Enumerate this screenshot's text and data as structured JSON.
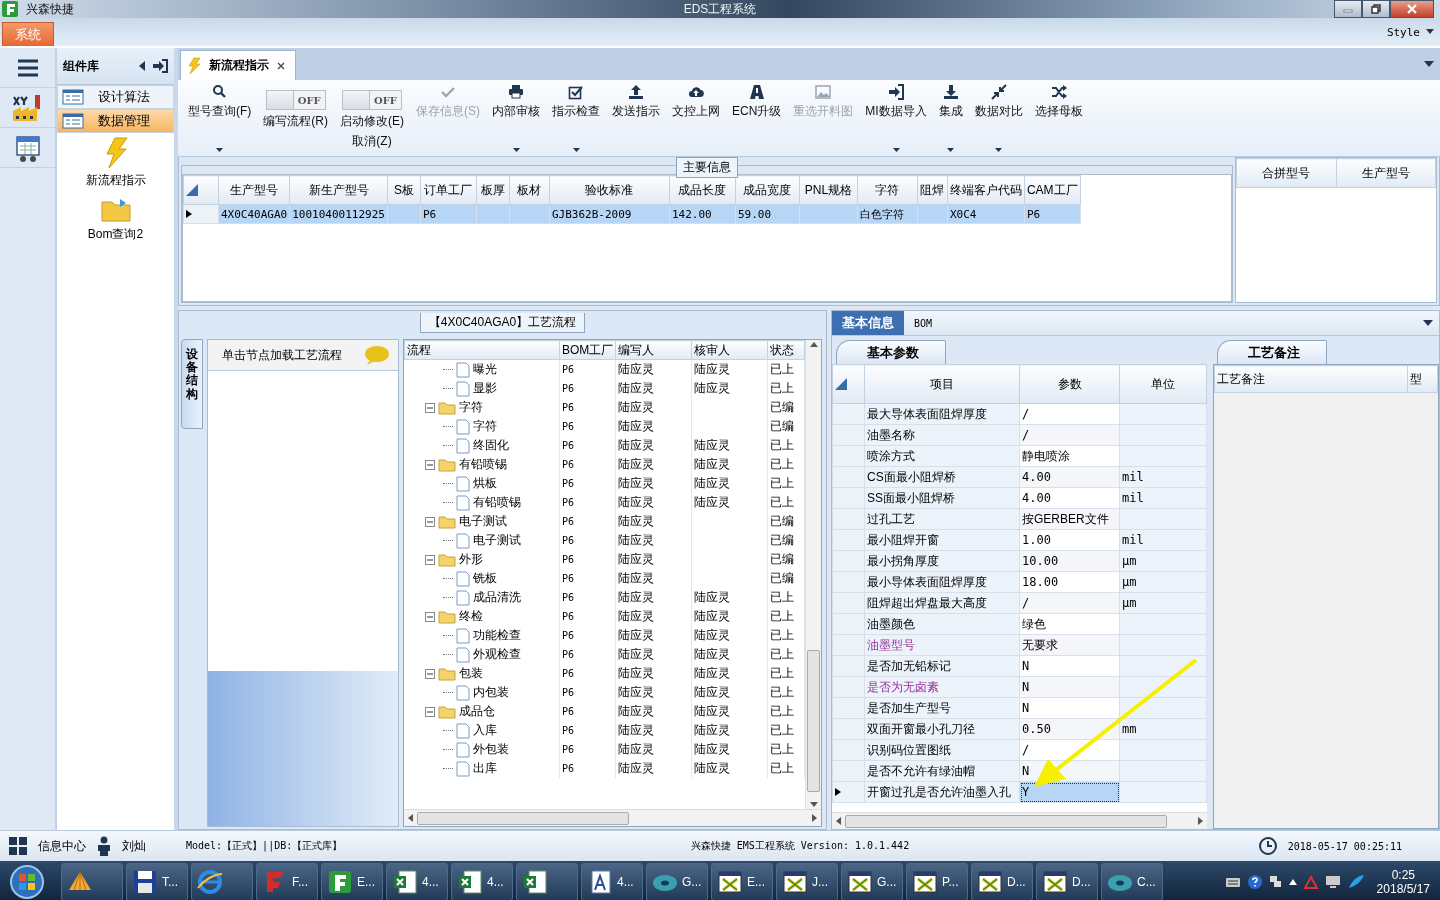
{
  "titlebar": {
    "app": "兴森快捷",
    "title": "EDS工程系统"
  },
  "menu": {
    "system": "系统",
    "style": "Style"
  },
  "component_panel": {
    "title": "组件库",
    "items": [
      {
        "label": "设计算法",
        "selected": false
      },
      {
        "label": "数据管理",
        "selected": true
      }
    ],
    "tools": [
      {
        "label": "新流程指示"
      },
      {
        "label": "Bom查询2"
      }
    ]
  },
  "doc_tabs": [
    {
      "label": "新流程指示",
      "selected": true
    }
  ],
  "toolbar": [
    {
      "kind": "button",
      "lines": [
        "型号查询(F)"
      ],
      "dropdown": true,
      "disabled": false
    },
    {
      "kind": "toggle",
      "text": "OFF",
      "on": false,
      "lines": [
        "编写流程(R)"
      ]
    },
    {
      "kind": "toggle",
      "text": "OFF",
      "on": false,
      "lines": [
        "启动修改(E)",
        "取消(Z)"
      ]
    },
    {
      "kind": "button",
      "lines": [
        "保存信息(S)"
      ],
      "dropdown": false,
      "disabled": true
    },
    {
      "kind": "button",
      "lines": [
        "内部审核"
      ],
      "dropdown": true,
      "disabled": false
    },
    {
      "kind": "button",
      "lines": [
        "指示检查"
      ],
      "dropdown": true,
      "disabled": false
    },
    {
      "kind": "button",
      "lines": [
        "发送指示"
      ],
      "dropdown": false,
      "disabled": false
    },
    {
      "kind": "button",
      "lines": [
        "文控上网"
      ],
      "dropdown": false,
      "disabled": false
    },
    {
      "kind": "button",
      "lines": [
        "ECN升级"
      ],
      "dropdown": false,
      "disabled": false
    },
    {
      "kind": "button",
      "lines": [
        "重选开料图"
      ],
      "dropdown": false,
      "disabled": true
    },
    {
      "kind": "button",
      "lines": [
        "MI数据导入"
      ],
      "dropdown": true,
      "disabled": false
    },
    {
      "kind": "button",
      "lines": [
        "集成"
      ],
      "dropdown": true,
      "disabled": false
    },
    {
      "kind": "button",
      "lines": [
        "数据对比"
      ],
      "dropdown": true,
      "disabled": false
    },
    {
      "kind": "button",
      "lines": [
        "选择母板"
      ],
      "dropdown": false,
      "disabled": false
    }
  ],
  "main_info": {
    "title": "主要信息",
    "columns": [
      "生产型号",
      "新生产型号",
      "S板",
      "订单工厂",
      "板厚",
      "板材",
      "验收标准",
      "成品长度",
      "成品宽度",
      "PNL规格",
      "字符",
      "阻焊",
      "终端客户代码",
      "CAM工厂"
    ],
    "rows": [
      {
        "selected": true,
        "cells": [
          "4X0C40AGA0",
          "10010400112925",
          null,
          "P6",
          null,
          null,
          "GJB362B-2009",
          "142.00",
          "59.00",
          null,
          "白色字符",
          null,
          "X0C4",
          "P6"
        ]
      }
    ],
    "side_columns": [
      "合拼型号",
      "生产型号"
    ]
  },
  "process": {
    "title": "【4X0C40AGA0】工艺流程",
    "side_tab": "设备结构",
    "hint": "单击节点加载工艺流程",
    "columns": [
      "流程",
      "BOM工厂",
      "编写人",
      "核审人",
      "状态"
    ],
    "nodes": [
      {
        "children": [
          {
            "kind": "doc",
            "label": "曝光",
            "bom": "P6",
            "writer": "陆应灵",
            "reviewer": "陆应灵",
            "status": "已上"
          },
          {
            "kind": "doc",
            "label": "显影",
            "bom": "P6",
            "writer": "陆应灵",
            "reviewer": "陆应灵",
            "status": "已上"
          }
        ]
      },
      {
        "kind": "folder",
        "expanded": true,
        "label": "字符",
        "bom": "P6",
        "writer": "陆应灵",
        "status": "已编",
        "children": [
          {
            "kind": "doc",
            "label": "字符",
            "bom": "P6",
            "writer": "陆应灵",
            "status": "已编"
          },
          {
            "kind": "doc",
            "label": "终固化",
            "bom": "P6",
            "writer": "陆应灵",
            "reviewer": "陆应灵",
            "status": "已上"
          }
        ]
      },
      {
        "kind": "folder",
        "expanded": true,
        "label": "有铅喷锡",
        "bom": "P6",
        "writer": "陆应灵",
        "reviewer": "陆应灵",
        "status": "已上",
        "children": [
          {
            "kind": "doc",
            "label": "烘板",
            "bom": "P6",
            "writer": "陆应灵",
            "reviewer": "陆应灵",
            "status": "已上"
          },
          {
            "kind": "doc",
            "label": "有铅喷锡",
            "bom": "P6",
            "writer": "陆应灵",
            "reviewer": "陆应灵",
            "status": "已上"
          }
        ]
      },
      {
        "kind": "folder",
        "expanded": true,
        "label": "电子测试",
        "bom": "P6",
        "writer": "陆应灵",
        "status": "已编",
        "children": [
          {
            "kind": "doc",
            "label": "电子测试",
            "bom": "P6",
            "writer": "陆应灵",
            "status": "已编"
          }
        ]
      },
      {
        "kind": "folder",
        "expanded": true,
        "label": "外形",
        "bom": "P6",
        "writer": "陆应灵",
        "status": "已编",
        "children": [
          {
            "kind": "doc",
            "label": "铣板",
            "bom": "P6",
            "writer": "陆应灵",
            "status": "已编"
          },
          {
            "kind": "doc",
            "label": "成品清洗",
            "bom": "P6",
            "writer": "陆应灵",
            "reviewer": "陆应灵",
            "status": "已上"
          }
        ]
      },
      {
        "kind": "folder",
        "expanded": true,
        "label": "终检",
        "bom": "P6",
        "writer": "陆应灵",
        "reviewer": "陆应灵",
        "status": "已上",
        "children": [
          {
            "kind": "doc",
            "label": "功能检查",
            "bom": "P6",
            "writer": "陆应灵",
            "reviewer": "陆应灵",
            "status": "已上"
          },
          {
            "kind": "doc",
            "label": "外观检查",
            "bom": "P6",
            "writer": "陆应灵",
            "reviewer": "陆应灵",
            "status": "已上"
          }
        ]
      },
      {
        "kind": "folder",
        "expanded": true,
        "label": "包装",
        "bom": "P6",
        "writer": "陆应灵",
        "reviewer": "陆应灵",
        "status": "已上",
        "children": [
          {
            "kind": "doc",
            "label": "内包装",
            "bom": "P6",
            "writer": "陆应灵",
            "reviewer": "陆应灵",
            "status": "已上"
          }
        ]
      },
      {
        "kind": "folder",
        "expanded": true,
        "label": "成品仓",
        "bom": "P6",
        "writer": "陆应灵",
        "reviewer": "陆应灵",
        "status": "已上",
        "children": [
          {
            "kind": "doc",
            "label": "入库",
            "bom": "P6",
            "writer": "陆应灵",
            "reviewer": "陆应灵",
            "status": "已上"
          },
          {
            "kind": "doc",
            "label": "外包装",
            "bom": "P6",
            "writer": "陆应灵",
            "reviewer": "陆应灵",
            "status": "已上"
          },
          {
            "kind": "doc",
            "label": "出库",
            "bom": "P6",
            "writer": "陆应灵",
            "reviewer": "陆应灵",
            "status": "已上"
          }
        ]
      }
    ]
  },
  "info": {
    "tabs": [
      {
        "label": "基本信息",
        "selected": true
      },
      {
        "label": "BOM",
        "selected": false
      }
    ],
    "params": {
      "tab": "基本参数",
      "columns": [
        "项目",
        "参数",
        "单位"
      ],
      "rows": [
        {
          "item": "最大导体表面阻焊厚度",
          "value": "/",
          "selected": false,
          "highlighted": false
        },
        {
          "item": "油墨名称",
          "value": "/",
          "selected": false,
          "highlighted": false
        },
        {
          "item": "喷涂方式",
          "value": "静电喷涂",
          "selected": false,
          "highlighted": false
        },
        {
          "item": "CS面最小阻焊桥",
          "value": "4.00",
          "unit": "mil",
          "selected": false,
          "highlighted": false
        },
        {
          "item": "SS面最小阻焊桥",
          "value": "4.00",
          "unit": "mil",
          "selected": false,
          "highlighted": false
        },
        {
          "item": "过孔工艺",
          "value": "按GERBER文件",
          "selected": false,
          "highlighted": false
        },
        {
          "item": "最小阻焊开窗",
          "value": "1.00",
          "unit": "mil",
          "selected": false,
          "highlighted": false
        },
        {
          "item": "最小拐角厚度",
          "value": "10.00",
          "unit": "μm",
          "selected": false,
          "highlighted": false
        },
        {
          "item": "最小导体表面阻焊厚度",
          "value": "18.00",
          "unit": "μm",
          "selected": false,
          "highlighted": false
        },
        {
          "item": "阻焊超出焊盘最大高度",
          "value": "/",
          "unit": "μm",
          "selected": false,
          "highlighted": false
        },
        {
          "item": "油墨颜色",
          "value": "绿色",
          "selected": false,
          "highlighted": false
        },
        {
          "item": "油墨型号",
          "value": "无要求",
          "selected": false,
          "highlighted": true
        },
        {
          "item": "是否加无铅标记",
          "value": "N",
          "selected": false,
          "highlighted": false
        },
        {
          "item": "是否为无卤素",
          "value": "N",
          "selected": false,
          "highlighted": true
        },
        {
          "item": "是否加生产型号",
          "value": "N",
          "selected": false,
          "highlighted": false
        },
        {
          "item": "双面开窗最小孔刀径",
          "value": "0.50",
          "unit": "mm",
          "selected": false,
          "highlighted": false
        },
        {
          "item": "识别码位置图纸",
          "value": "/",
          "selected": false,
          "highlighted": false
        },
        {
          "item": "是否不允许有绿油帽",
          "value": "N",
          "selected": false,
          "highlighted": false
        },
        {
          "item": "开窗过孔是否允许油墨入孔",
          "value": "Y",
          "selected": true,
          "highlighted": false
        }
      ]
    },
    "notes": {
      "tab": "工艺备注",
      "columns": [
        "工艺备注",
        "型"
      ]
    }
  },
  "status_bar": {
    "info_center": "信息中心",
    "user": "刘灿",
    "model": "Model:【正式】||DB:【正式库】",
    "product": "兴森快捷 EMS工程系统 Version: 1.0.1.442",
    "datetime": "2018-05-17 00:25:11"
  },
  "taskbar": {
    "items": [
      {
        "kind": "shell"
      },
      {
        "kind": "floppy",
        "label": "T..."
      },
      {
        "kind": "browser"
      },
      {
        "kind": "red-app",
        "label": "F..."
      },
      {
        "kind": "green-app",
        "label": "E..."
      },
      {
        "kind": "sheet",
        "label": "4..."
      },
      {
        "kind": "sheet",
        "label": "4..."
      },
      {
        "kind": "sheet"
      },
      {
        "kind": "doc",
        "label": "4..."
      },
      {
        "kind": "disc",
        "label": "G..."
      },
      {
        "kind": "cross",
        "label": "E..."
      },
      {
        "kind": "cross",
        "label": "J..."
      },
      {
        "kind": "cross",
        "label": "G..."
      },
      {
        "kind": "cross",
        "label": "P..."
      },
      {
        "kind": "cross",
        "label": "D..."
      },
      {
        "kind": "cross",
        "label": "D..."
      },
      {
        "kind": "disc",
        "label": "C..."
      }
    ],
    "clock": {
      "time": "0:25",
      "date": "2018/5/17"
    }
  }
}
